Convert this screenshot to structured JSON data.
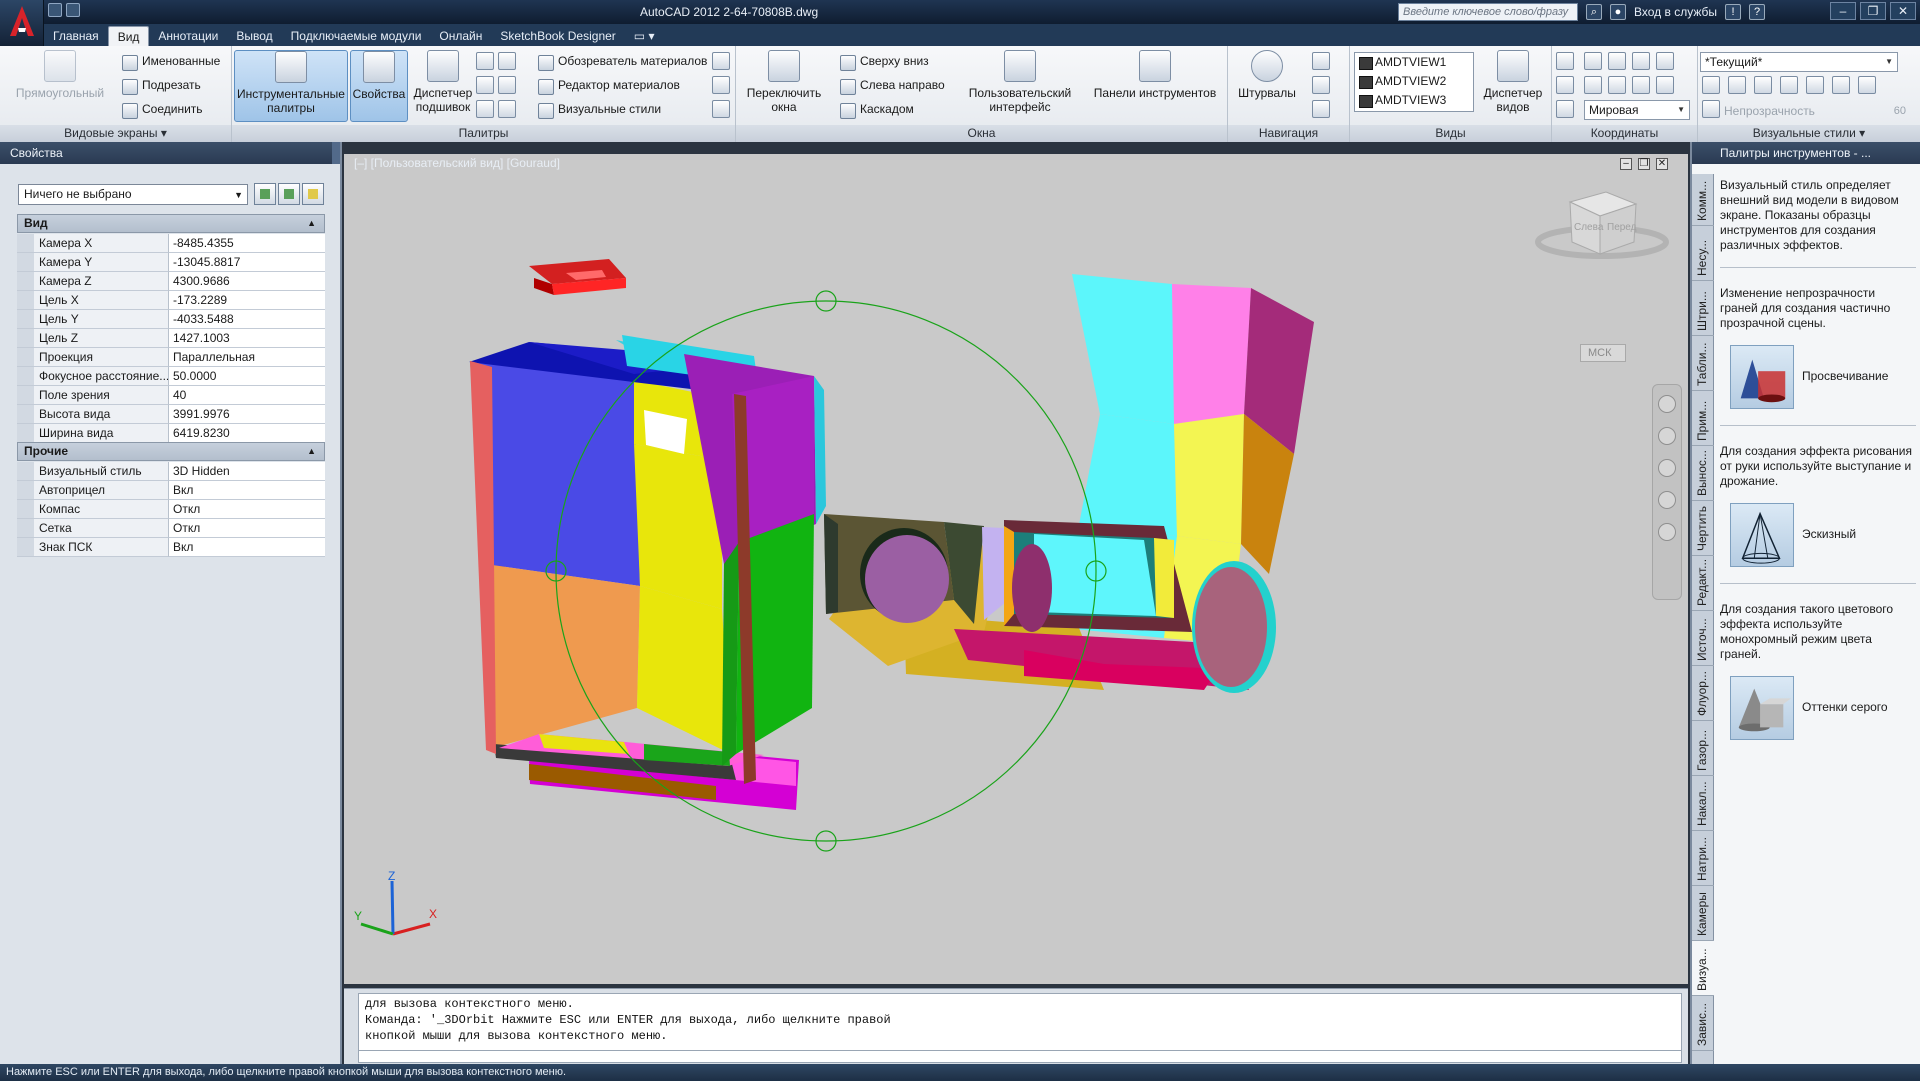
{
  "app": {
    "title": "AutoCAD 2012   2-64-70808B.dwg",
    "search_placeholder": "Введите ключевое слово/фразу",
    "signin": "Вход в службы"
  },
  "tabs": [
    "Главная",
    "Вид",
    "Аннотации",
    "Вывод",
    "Подключаемые модули",
    "Онлайн",
    "SketchBook Designer"
  ],
  "active_tab": "Вид",
  "ribbon": {
    "viewports": {
      "title": "Видовые экраны",
      "rect": "Прямоугольный",
      "named": "Именованные",
      "clip": "Подрезать",
      "join": "Соединить"
    },
    "palettes": {
      "title": "Палитры",
      "tool_palettes": "Инструментальные палитры",
      "properties": "Свойства",
      "sheet_set": "Диспетчер подшивок",
      "materials_browser": "Обозреватель материалов",
      "materials_editor": "Редактор материалов",
      "visual_styles": "Визуальные стили"
    },
    "window": {
      "title": "Окна",
      "switch": "Переключить окна",
      "top_down": "Сверху вниз",
      "left_right": "Слева направо",
      "cascade": "Каскадом",
      "ui": "Пользовательский интерфейс",
      "toolbars": "Панели инструментов"
    },
    "navigate": {
      "title": "Навигация",
      "wheels": "Штурвалы"
    },
    "views": {
      "title": "Виды",
      "items": [
        "AMDTVIEW1",
        "AMDTVIEW2",
        "AMDTVIEW3"
      ],
      "manager": "Диспетчер видов"
    },
    "coords": {
      "title": "Координаты",
      "world": "Мировая"
    },
    "vstyles": {
      "title": "Визуальные стили",
      "current": "*Текущий*",
      "opacity": "Непрозрачность",
      "opacity_value": "60"
    }
  },
  "properties": {
    "title": "Свойства",
    "selection": "Ничего не выбрано",
    "view_section": "Вид",
    "view_rows": [
      {
        "k": "Камера X",
        "v": "-8485.4355"
      },
      {
        "k": "Камера Y",
        "v": "-13045.8817"
      },
      {
        "k": "Камера Z",
        "v": "4300.9686"
      },
      {
        "k": "Цель X",
        "v": "-173.2289"
      },
      {
        "k": "Цель Y",
        "v": "-4033.5488"
      },
      {
        "k": "Цель Z",
        "v": "1427.1003"
      },
      {
        "k": "Проекция",
        "v": "Параллельная"
      },
      {
        "k": "Фокусное расстояние...",
        "v": "50.0000"
      },
      {
        "k": "Поле зрения",
        "v": "40"
      },
      {
        "k": "Высота вида",
        "v": "3991.9976"
      },
      {
        "k": "Ширина вида",
        "v": "6419.8230"
      }
    ],
    "misc_section": "Прочие",
    "misc_rows": [
      {
        "k": "Визуальный стиль",
        "v": "3D Hidden"
      },
      {
        "k": "Автоприцел",
        "v": "Вкл"
      },
      {
        "k": "Компас",
        "v": "Откл"
      },
      {
        "k": "Сетка",
        "v": "Откл"
      },
      {
        "k": "Знак ПСК",
        "v": "Вкл"
      }
    ]
  },
  "viewport": {
    "label": "[–] [Пользовательский вид] [Gouraud]",
    "ucs_label": "МСК",
    "cube_left": "Слева",
    "cube_front": "Перед",
    "axes": {
      "x": "X",
      "y": "Y",
      "z": "Z"
    },
    "orbit_color": "#1aa31a"
  },
  "command": {
    "lines": [
      "для вызова контекстного меню.",
      "Команда: '_3DOrbit Нажмите ESC или ENTER для выхода, либо щелкните правой",
      "кнопкой мыши для вызова контекстного меню."
    ]
  },
  "tool_palette": {
    "title": "Палитры инструментов - ...",
    "vtabs": [
      "Комм...",
      "Несу...",
      "Штри...",
      "Табли...",
      "Прим...",
      "Вынос...",
      "Чертить",
      "Редакт...",
      "Источ...",
      "Флуор...",
      "Газор...",
      "Накал...",
      "Натри...",
      "Камеры",
      "Визуа...",
      "Завис..."
    ],
    "active_vtab": "Визуа...",
    "intro": "Визуальный стиль определяет внешний вид модели в видовом экране. Показаны образцы инструментов для создания различных эффектов.",
    "sections": [
      {
        "text": "Изменение непрозрачности граней для создания частично прозрачной сцены.",
        "tool": "Просвечивание"
      },
      {
        "text": "Для создания эффекта рисования от руки используйте выступание и дрожание.",
        "tool": "Эскизный"
      },
      {
        "text": "Для создания такого цветового эффекта используйте монохромный режим цвета граней.",
        "tool": "Оттенки серого"
      }
    ]
  },
  "status": "Нажмите ESC или ENTER для выхода, либо щелкните правой кнопкой мыши для вызова контекстного меню."
}
